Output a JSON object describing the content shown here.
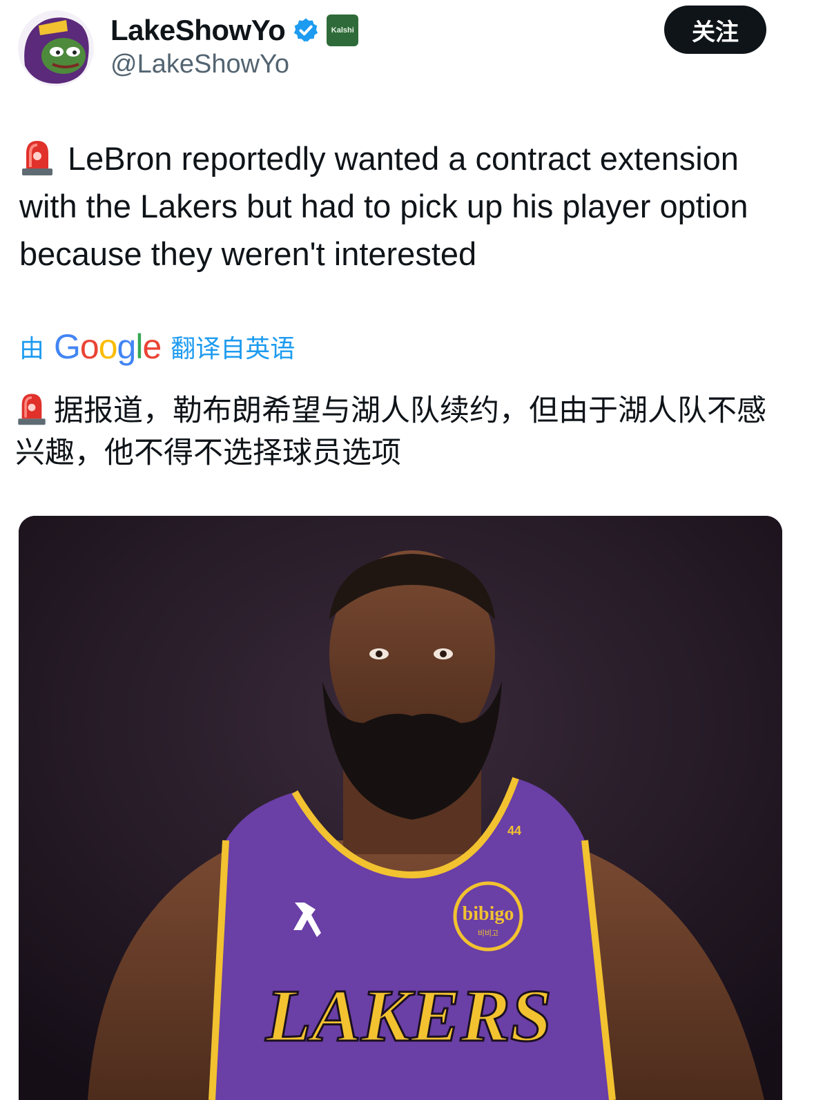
{
  "header": {
    "display_name": "LakeShowYo",
    "handle": "@LakeShowYo",
    "verified_icon": "verified-badge-icon",
    "affiliate_badge_text": "Kalshi",
    "follow_label": "关注"
  },
  "tweet": {
    "emoji": "rotating-light-icon",
    "text": "LeBron reportedly wanted a contract extension with the Lakers but had to pick up his player option because they weren't interested"
  },
  "translation": {
    "prefix": "由",
    "logo_text": "Google",
    "suffix": "翻译自英语",
    "text": "据报道，勒布朗希望与湖人队续约，但由于湖人队不感兴趣，他不得不选择球员选项"
  },
  "media": {
    "jersey_number": "44",
    "sponsor": "bibigo",
    "sponsor_sub": "비비고",
    "team": "LAKERS"
  },
  "colors": {
    "link": "#1d9bf0",
    "text": "#0f1419",
    "secondary": "#536471",
    "jersey_purple": "#6a3fa6",
    "jersey_gold": "#f2c230"
  }
}
